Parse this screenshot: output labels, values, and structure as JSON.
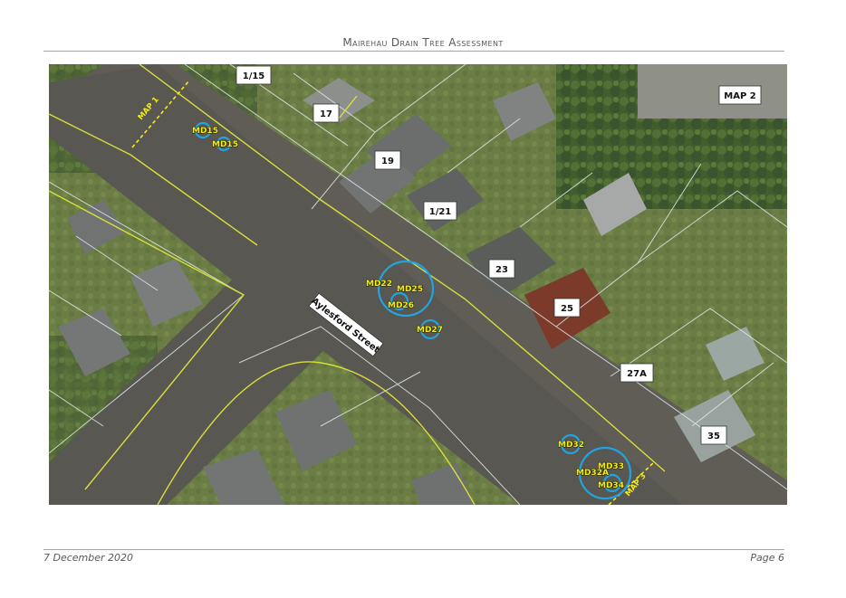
{
  "header": {
    "title": "Mairehau Drain Tree Assessment"
  },
  "map": {
    "street_name": "Aylesford Street",
    "map_refs": [
      "MAP 1",
      "MAP 2",
      "MAP 3"
    ],
    "lots": [
      "1/15",
      "17",
      "19",
      "1/21",
      "23",
      "25",
      "27A",
      "35"
    ],
    "trees": [
      "MD15",
      "MD15",
      "MD22",
      "MD25",
      "MD26",
      "MD27",
      "MD32",
      "MD33",
      "MD32A",
      "MD34"
    ],
    "colors": {
      "tree_circle": "#22a3e0",
      "label": "#f2ea1e",
      "boundary": "#d9df3a",
      "parcel": "#e8f0f0"
    }
  },
  "footer": {
    "date": "7 December 2020",
    "page": "Page 6"
  }
}
